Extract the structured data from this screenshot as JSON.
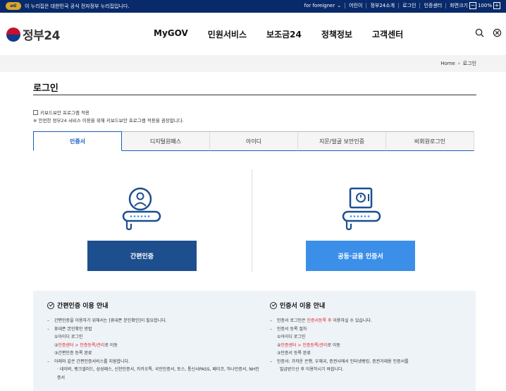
{
  "topbar": {
    "notice": "이 누리집은 대한민국 공식 전자정부 누리집입니다.",
    "logo": "eG",
    "links": [
      "for foreigner",
      "어린이",
      "정부24소개",
      "로그인",
      "인증센터",
      "화면크기"
    ],
    "zoom_minus": "−",
    "zoom_value": "100%",
    "zoom_plus": "+"
  },
  "header": {
    "logo_text": "정부24",
    "nav": [
      "MyGOV",
      "민원서비스",
      "보조금24",
      "정책정보",
      "고객센터"
    ]
  },
  "breadcrumb": {
    "home": "Home",
    "current": "로그인"
  },
  "page": {
    "title": "로그인",
    "keyboard_label": "키보드보안 프로그램 적용",
    "keyboard_note": "※ 안전한 정부24 서비스 이용을 위해 키보드보안 프로그램 적용을 권장합니다."
  },
  "tabs": [
    "인증서",
    "디지털원패스",
    "아이디",
    "지문/얼굴 보안인증",
    "비회원로그인"
  ],
  "auth": {
    "simple_button": "간편인증",
    "cert_button": "공동·금융 인증서"
  },
  "info": {
    "left": {
      "title": "간편인증 이용 안내",
      "lines": [
        {
          "type": "bullet",
          "text": "간편인증을 이용하기 위해서는 [휴대폰 본인확인]이 필요합니다."
        },
        {
          "type": "bullet",
          "text": "휴대폰 본인확인 방법"
        },
        {
          "type": "sub",
          "text": "①아이디 로그인"
        },
        {
          "type": "sub",
          "pre": "②",
          "red": "인증센터 > 인증등록/관리",
          "post": "로 이동"
        },
        {
          "type": "sub",
          "text": "③간편인증 등록 완료"
        },
        {
          "type": "bullet",
          "text": "아래와 같은 간편인증서비스를 지원합니다."
        },
        {
          "type": "subsub",
          "text": "· 네이버, 뱅크샐러드, 삼성패스, 신한인증서, 카카오톡, 국민인증서, 토스, 통신사PASS, 페이코, 하나인증서, NH인"
        },
        {
          "type": "subsub",
          "text": "증서"
        }
      ]
    },
    "right": {
      "title": "인증서 이용 안내",
      "lines": [
        {
          "type": "bullet",
          "pre": "인증서 로그인은 ",
          "red": "인증서등록 후",
          "post": " 이용하실 수 있습니다."
        },
        {
          "type": "bullet",
          "text": "인증서 등록 절차"
        },
        {
          "type": "sub",
          "text": "①아이디 로그인"
        },
        {
          "type": "sub",
          "pre": "②",
          "red": "인증센터 > 인증등록/관리",
          "post": "로 이동"
        },
        {
          "type": "sub",
          "text": "③인증서 등록 완료"
        },
        {
          "type": "bullet",
          "text": "인증서: 가까운 은행, 우체국, 증권사에서 인터넷뱅킹, 증권거래용 인증서를"
        },
        {
          "type": "subsub",
          "text": "발급받으신 후 이용하시기 바랍니다."
        }
      ]
    }
  },
  "colors": {
    "topbar": "#082a6b",
    "accent": "#1a5dc0",
    "simple_button": "#1d4f8e",
    "cert_button": "#3b8fe8",
    "highlight": "#d22"
  }
}
